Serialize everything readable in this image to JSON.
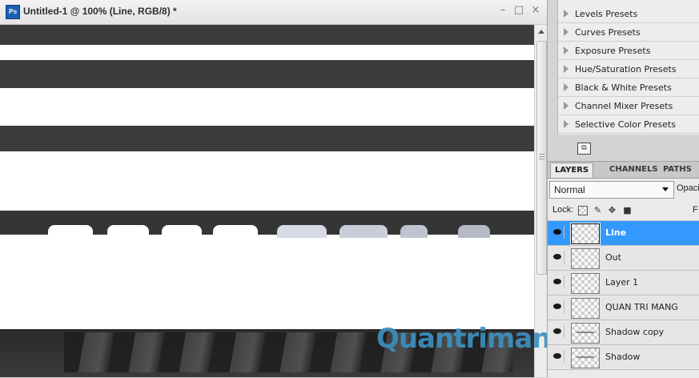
{
  "document": {
    "app_icon": "Ps",
    "title": "Untitled-1 @ 100% (Line, RGB/8) *",
    "minimize": "–",
    "maximize": "□",
    "close": "×",
    "watermark": "Quantrimang"
  },
  "adjustments": {
    "presets": [
      "Levels Presets",
      "Curves Presets",
      "Exposure Presets",
      "Hue/Saturation Presets",
      "Black & White Presets",
      "Channel Mixer Presets",
      "Selective Color Presets"
    ]
  },
  "layers_panel": {
    "tabs": [
      "LAYERS",
      "CHANNELS",
      "PATHS"
    ],
    "active_tab": "LAYERS",
    "blend_mode": "Normal",
    "opacity_label": "Opaci",
    "lock_label": "Lock:",
    "fill_label": "F",
    "layers": [
      {
        "name": "Line",
        "selected": true,
        "visible": true
      },
      {
        "name": "Out",
        "selected": false,
        "visible": true
      },
      {
        "name": "Layer 1",
        "selected": false,
        "visible": true
      },
      {
        "name": "QUAN TRI MANG",
        "selected": false,
        "visible": true
      },
      {
        "name": "Shadow copy",
        "selected": false,
        "visible": true
      },
      {
        "name": "Shadow",
        "selected": false,
        "visible": true
      }
    ]
  },
  "colors": {
    "selection": "#3399ff",
    "band": "#3c3c3c",
    "watermark": "#3d8fbf"
  },
  "icons": {
    "panel_toggle": "adjustment-panel-icon",
    "lock_transparency": "lock-transparency-icon",
    "lock_image": "brush-icon",
    "lock_position": "move-icon",
    "lock_all": "lock-icon"
  }
}
